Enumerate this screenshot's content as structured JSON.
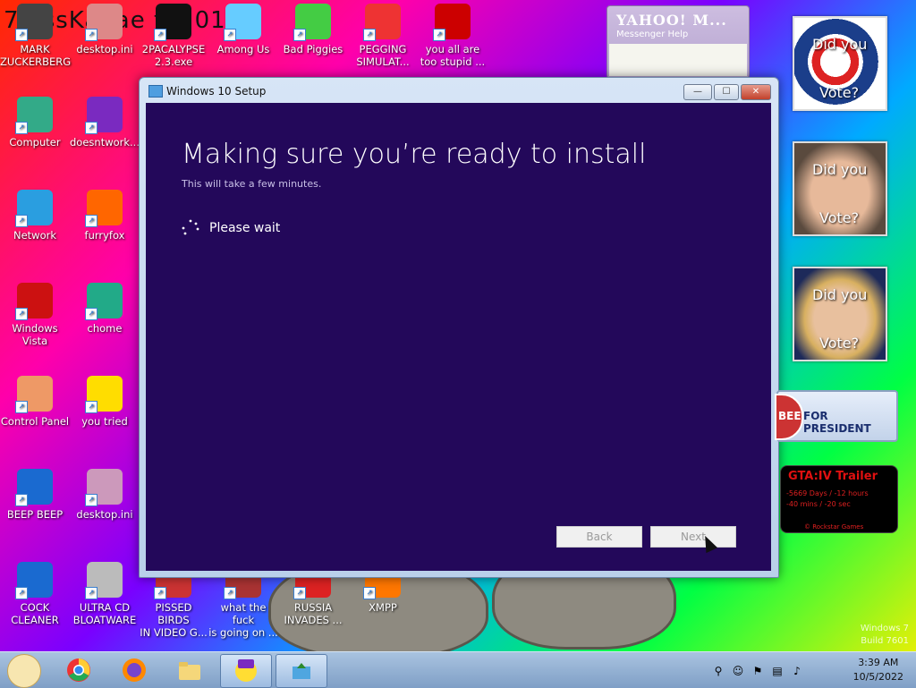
{
  "desktop": {
    "background_text": "7  ossKanae  tio  012",
    "watermark": {
      "line1": "Windows 7",
      "line2": "Build 7601"
    },
    "icons": [
      {
        "label": "MARK\nZUCKERBERG",
        "color": "#444"
      },
      {
        "label": "desktop.ini",
        "color": "#d88"
      },
      {
        "label": "2PACALYPSE\n2.3.exe",
        "color": "#111"
      },
      {
        "label": "Among Us",
        "color": "#6cf"
      },
      {
        "label": "Bad Piggies",
        "color": "#4c4"
      },
      {
        "label": "PEGGING\nSIMULAT...",
        "color": "#e33"
      },
      {
        "label": "you all are\ntoo stupid ...",
        "color": "#c00"
      },
      {
        "label": "Computer",
        "color": "#3a8"
      },
      {
        "label": "doesntwork...",
        "color": "#7a2ac0"
      },
      {
        "label": "Network",
        "color": "#2a9ee0"
      },
      {
        "label": "furryfox",
        "color": "#f60"
      },
      {
        "label": "Windows\nVista",
        "color": "#c11"
      },
      {
        "label": "chome",
        "color": "#2a8"
      },
      {
        "label": "Control Panel",
        "color": "#e96"
      },
      {
        "label": "you tried",
        "color": "#fd0"
      },
      {
        "label": "BEEP BEEP",
        "color": "#1a6ad0"
      },
      {
        "label": "desktop.ini",
        "color": "#c9b"
      },
      {
        "label": "COCK\nCLEANER",
        "color": "#1a6ad0"
      },
      {
        "label": "ULTRA CD\nBLOATWARE",
        "color": "#bbb"
      },
      {
        "label": "PISSED BIRDS\nIN VIDEO G...",
        "color": "#c33"
      },
      {
        "label": "what the fuck\nis going on ...",
        "color": "#a33"
      },
      {
        "label": "RUSSIA\nINVADES ...",
        "color": "#d22"
      },
      {
        "label": "XMPP",
        "color": "#f70"
      }
    ]
  },
  "setup_window": {
    "title": "Windows 10 Setup",
    "heading": "Making sure you’re ready to install",
    "subtitle": "This will take a few minutes.",
    "status": "Please wait",
    "back_label": "Back",
    "next_label": "Next",
    "min_label": "—",
    "max_label": "☐",
    "close_label": "✕"
  },
  "yahoo": {
    "logo": "YAHOO! M...",
    "menu": "Messenger    Help"
  },
  "posters": [
    {
      "line1": "Did you",
      "line2": "Vote?"
    },
    {
      "line1": "Did you",
      "line2": "Vote?"
    },
    {
      "line1": "Did you",
      "line2": "Vote?"
    }
  ],
  "president": {
    "prefix": "BEE",
    "text": "FOR PRESIDENT"
  },
  "gta": {
    "title": "GTA:IV Trailer",
    "count1": "-5669 Days / -12 hours",
    "count2": "-40 mins / -20 sec",
    "credit": "© Rockstar Games"
  },
  "taskbar": {
    "time": "3:39 AM",
    "date": "10/5/2022"
  }
}
